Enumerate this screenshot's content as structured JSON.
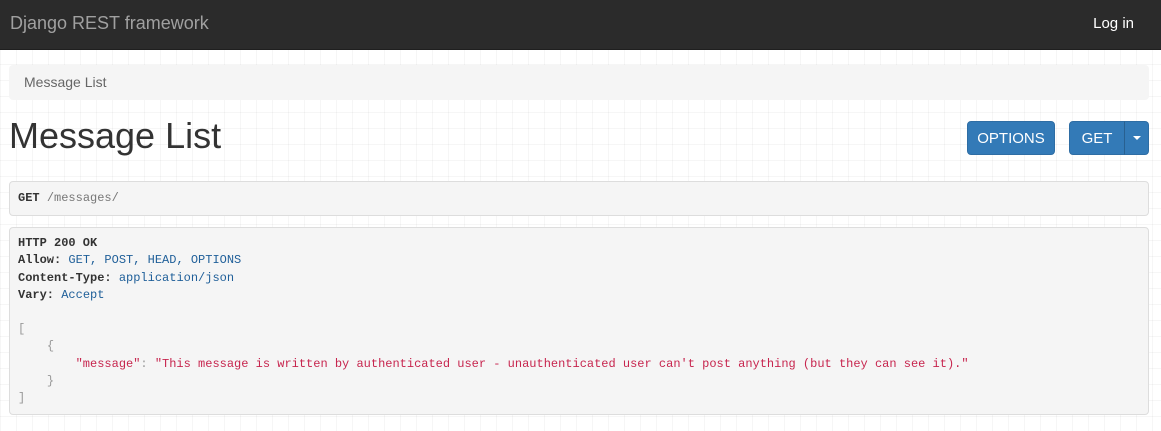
{
  "navbar": {
    "brand": "Django REST framework",
    "login_label": "Log in"
  },
  "breadcrumb": {
    "current": "Message List"
  },
  "page": {
    "title": "Message List"
  },
  "buttons": {
    "options_label": "OPTIONS",
    "get_label": "GET"
  },
  "request": {
    "method": "GET",
    "path": "/messages/"
  },
  "response": {
    "status_line": "HTTP 200 OK",
    "headers": [
      {
        "key": "Allow:",
        "value": "GET, POST, HEAD, OPTIONS"
      },
      {
        "key": "Content-Type:",
        "value": "application/json"
      },
      {
        "key": "Vary:",
        "value": "Accept"
      }
    ],
    "body": {
      "open_bracket": "[",
      "open_brace": "{",
      "key": "\"message\"",
      "colon": ": ",
      "value": "\"This message is written by authenticated user - unauthenticated user can't post anything (but they can see it).\"",
      "close_brace": "}",
      "close_bracket": "]"
    }
  },
  "colors": {
    "navbar_bg": "#2b2b2b",
    "button_primary": "#337ab7",
    "json_string": "#c7254e",
    "header_value": "#1f5f99"
  }
}
